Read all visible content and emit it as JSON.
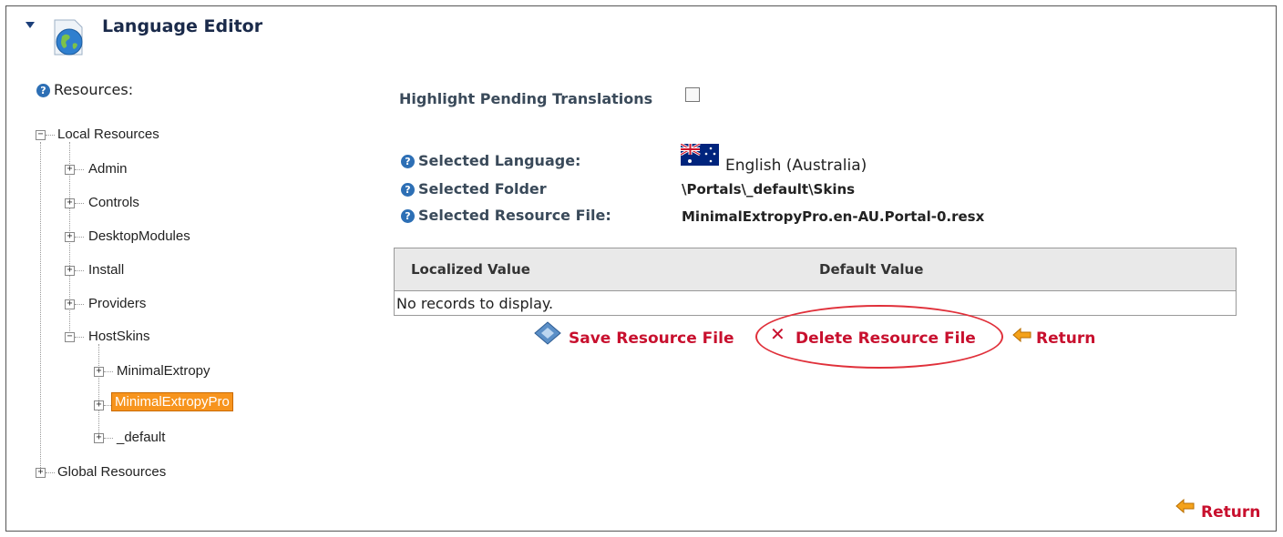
{
  "header": {
    "title": "Language Editor"
  },
  "resources_label": "Resources:",
  "tree": {
    "local": "Local Resources",
    "admin": "Admin",
    "controls": "Controls",
    "desktop_modules": "DesktopModules",
    "install": "Install",
    "providers": "Providers",
    "host_skins": "HostSkins",
    "minimal_extropy": "MinimalExtropy",
    "minimal_extropy_pro": "MinimalExtropyPro",
    "default": "_default",
    "global": "Global Resources"
  },
  "highlight_label": "Highlight Pending Translations",
  "selected": {
    "language_label": "Selected Language:",
    "language_value": "English (Australia)",
    "folder_label": "Selected Folder",
    "folder_value": "\\Portals\\_default\\Skins",
    "file_label": "Selected Resource File:",
    "file_value": "MinimalExtropyPro.en-AU.Portal-0.resx"
  },
  "grid": {
    "col_localized": "Localized Value",
    "col_default": "Default Value",
    "empty": "No records to display."
  },
  "actions": {
    "save": "Save Resource File",
    "delete": "Delete Resource File",
    "return": "Return"
  },
  "footer_return": "Return"
}
